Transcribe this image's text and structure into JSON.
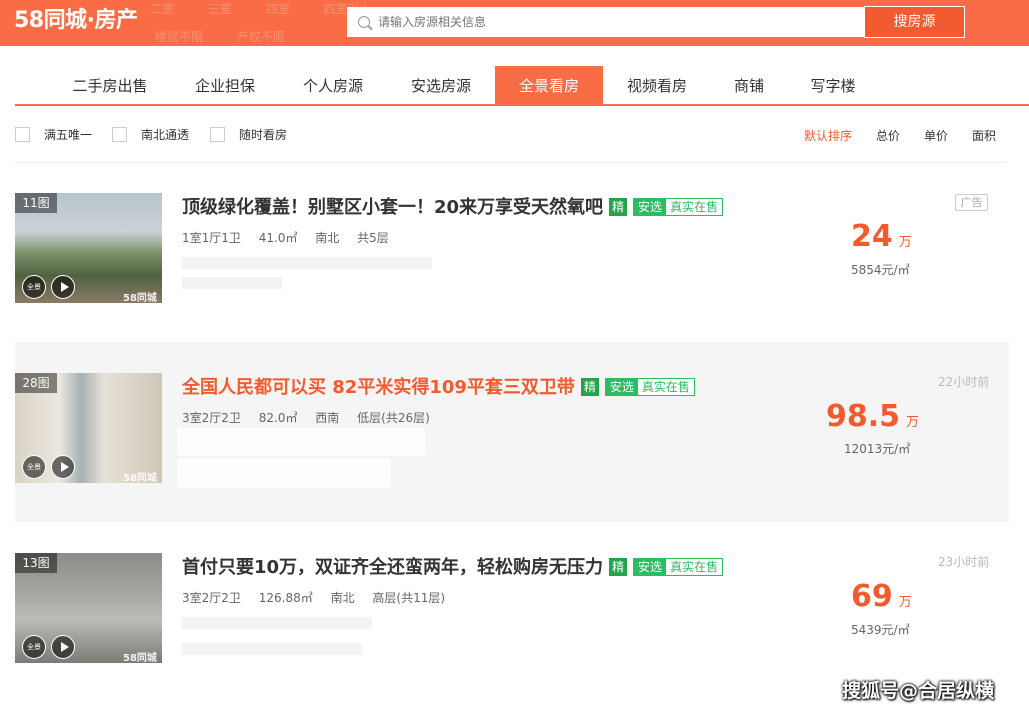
{
  "header": {
    "logo": "58同城·房产",
    "search_placeholder": "请输入房源相关信息",
    "search_button": "搜房源",
    "faint_row1": [
      "二室",
      "三室",
      "四室",
      "四室以上"
    ],
    "faint_row2": [
      "楼层不限",
      "产权不限"
    ]
  },
  "tabs": [
    "二手房出售",
    "企业担保",
    "个人房源",
    "安选房源",
    "全景看房",
    "视频看房",
    "商铺",
    "写字楼"
  ],
  "active_tab": "全景看房",
  "filters": {
    "checks": [
      "满五唯一",
      "南北通透",
      "随时看房"
    ],
    "sorts": [
      "默认排序",
      "总价",
      "单价",
      "面积"
    ]
  },
  "listings": [
    {
      "photo_count": "11图",
      "title": "顶级绿化覆盖！别墅区小套一！20来万享受天然氧吧",
      "jing": "精",
      "anxuan": "安选",
      "real": "真实在售",
      "layout": "1室1厅1卫",
      "area": "41.0㎡",
      "direction": "南北",
      "floor": "共5层",
      "price": "24",
      "price_unit": "万",
      "unit_price": "5854元/㎡",
      "tag": "广告",
      "watermark": "58同城",
      "pano": "全景"
    },
    {
      "photo_count": "28图",
      "title": "全国人民都可以买 82平米实得109平套三双卫带",
      "jing": "精",
      "anxuan": "安选",
      "real": "真实在售",
      "layout": "3室2厅2卫",
      "area": "82.0㎡",
      "direction": "西南",
      "floor": "低层(共26层)",
      "price": "98.5",
      "price_unit": "万",
      "unit_price": "12013元/㎡",
      "time": "22小时前",
      "watermark": "58同城",
      "pano": "全景"
    },
    {
      "photo_count": "13图",
      "title": "首付只要10万，双证齐全还蛮两年，轻松购房无压力",
      "jing": "精",
      "anxuan": "安选",
      "real": "真实在售",
      "layout": "3室2厅2卫",
      "area": "126.88㎡",
      "direction": "南北",
      "floor": "高层(共11层)",
      "price": "69",
      "price_unit": "万",
      "unit_price": "5439元/㎡",
      "time": "23小时前",
      "watermark": "58同城",
      "pano": "全景"
    }
  ],
  "footer_watermark": "搜狐号@合居纵横"
}
